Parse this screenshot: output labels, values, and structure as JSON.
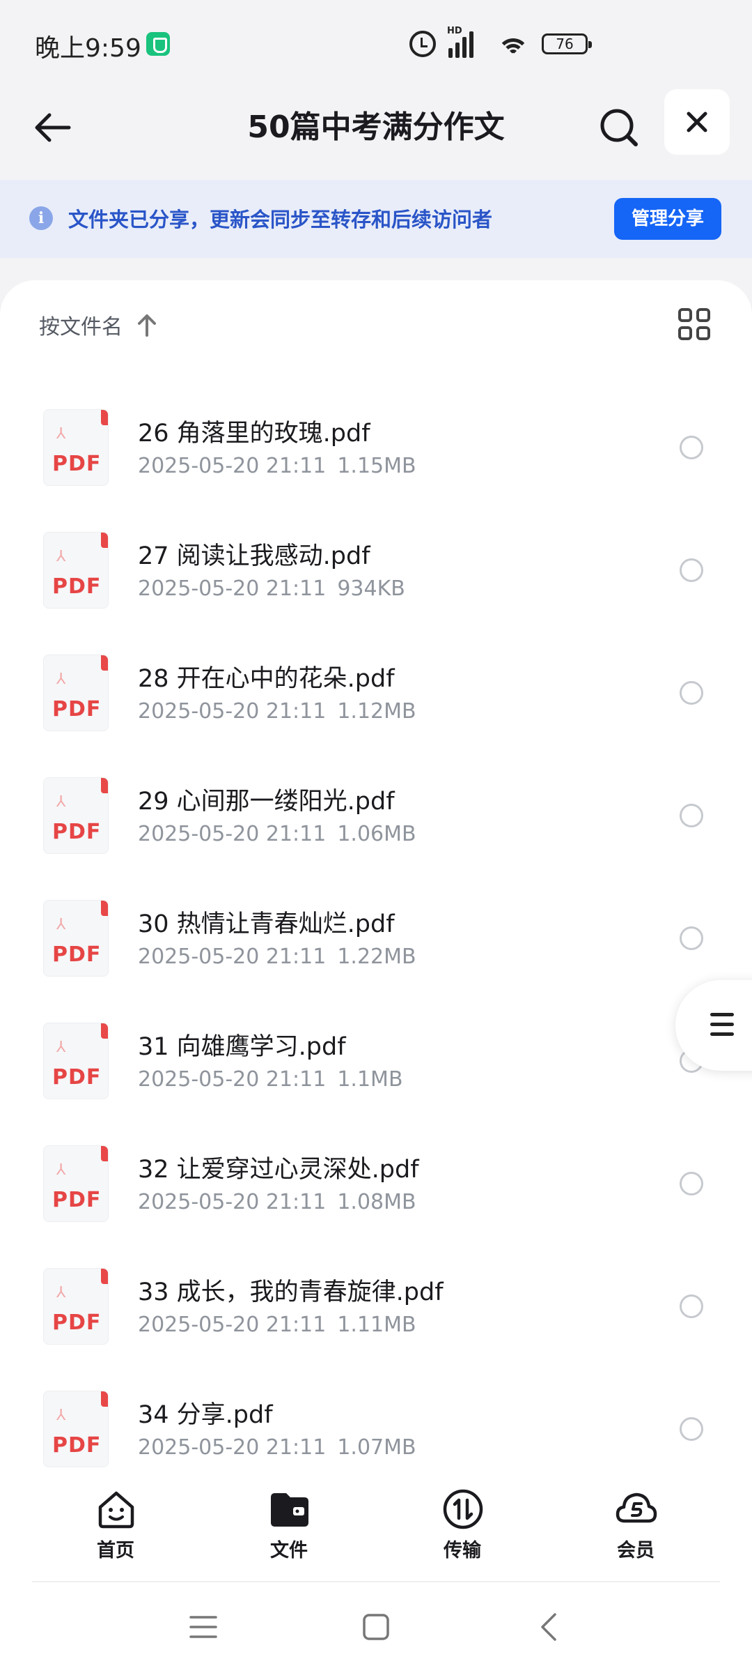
{
  "status_bar": {
    "time": "晚上9:59",
    "hd_label": "HD",
    "battery_level": "76"
  },
  "header": {
    "title": "50篇中考满分作文"
  },
  "share_banner": {
    "message": "文件夹已分享，更新会同步至转存和后续访问者",
    "button_label": "管理分享"
  },
  "sort": {
    "label": "按文件名"
  },
  "files": [
    {
      "name": "26 角落里的玫瑰.pdf",
      "date": "2025-05-20 21:11",
      "size": "1.15MB"
    },
    {
      "name": "27 阅读让我感动.pdf",
      "date": "2025-05-20 21:11",
      "size": "934KB"
    },
    {
      "name": "28 开在心中的花朵.pdf",
      "date": "2025-05-20 21:11",
      "size": "1.12MB"
    },
    {
      "name": "29 心间那一缕阳光.pdf",
      "date": "2025-05-20 21:11",
      "size": "1.06MB"
    },
    {
      "name": "30 热情让青春灿烂.pdf",
      "date": "2025-05-20 21:11",
      "size": "1.22MB"
    },
    {
      "name": "31 向雄鹰学习.pdf",
      "date": "2025-05-20 21:11",
      "size": "1.1MB"
    },
    {
      "name": "32 让爱穿过心灵深处.pdf",
      "date": "2025-05-20 21:11",
      "size": "1.08MB"
    },
    {
      "name": "33 成长，我的青春旋律.pdf",
      "date": "2025-05-20 21:11",
      "size": "1.11MB"
    },
    {
      "name": "34 分享.pdf",
      "date": "2025-05-20 21:11",
      "size": "1.07MB"
    }
  ],
  "file_icon_label": "PDF",
  "tabs": [
    {
      "label": "首页",
      "icon": "smile-home-icon"
    },
    {
      "label": "文件",
      "icon": "folder-icon",
      "active": true
    },
    {
      "label": "传输",
      "icon": "transfer-icon"
    },
    {
      "label": "会员",
      "icon": "vip-cloud-icon"
    }
  ],
  "colors": {
    "accent": "#1565f6",
    "banner_bg": "#e8edf9",
    "banner_text": "#2a55c8",
    "pdf_red": "#e64545"
  }
}
